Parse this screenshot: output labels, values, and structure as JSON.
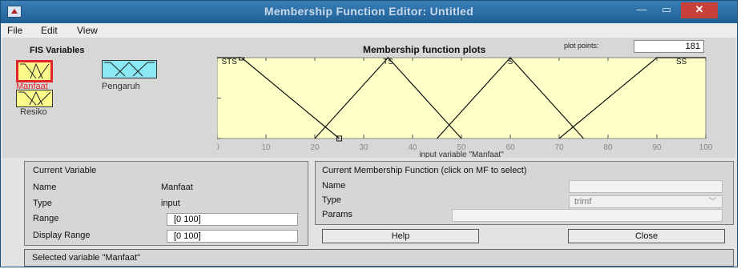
{
  "window": {
    "title": "Membership Function Editor: Untitled",
    "controls": {
      "minimize": "—",
      "maximize": "▭",
      "close": "✕"
    }
  },
  "menu": [
    "File",
    "Edit",
    "View"
  ],
  "fis": {
    "label": "FIS Variables",
    "variables": [
      {
        "name": "Manfaat",
        "selected": true,
        "kind": "input"
      },
      {
        "name": "Pengaruh",
        "selected": false,
        "kind": "output"
      },
      {
        "name": "Resiko",
        "selected": false,
        "kind": "input"
      }
    ]
  },
  "plot": {
    "title": "Membership function plots",
    "plot_points_label": "plot points:",
    "plot_points_value": "181",
    "xlabel": "input variable \"Manfaat\"",
    "xlim": [
      0,
      100
    ],
    "ylim": [
      0,
      1
    ],
    "xticks": [
      "0",
      "10",
      "20",
      "30",
      "40",
      "50",
      "60",
      "70",
      "80",
      "90",
      "100"
    ],
    "yticks": [
      "0",
      "0.5",
      "1"
    ],
    "background": "#ffffc8",
    "mfs": [
      {
        "name": "STS",
        "type": "trimf",
        "params": [
          0,
          5,
          25
        ],
        "points": [
          [
            0,
            1
          ],
          [
            5,
            1
          ],
          [
            25,
            0
          ]
        ]
      },
      {
        "name": "TS",
        "type": "trimf",
        "params": [
          20,
          35,
          50
        ],
        "points": [
          [
            20,
            0
          ],
          [
            35,
            1
          ],
          [
            50,
            0
          ]
        ]
      },
      {
        "name": "S",
        "type": "trimf",
        "params": [
          45,
          60,
          75
        ],
        "points": [
          [
            45,
            0
          ],
          [
            60,
            1
          ],
          [
            75,
            0
          ]
        ]
      },
      {
        "name": "SS",
        "type": "trimf",
        "params": [
          70,
          90,
          100
        ],
        "points": [
          [
            70,
            0
          ],
          [
            90,
            1
          ],
          [
            100,
            1
          ]
        ]
      }
    ]
  },
  "current_variable": {
    "title": "Current Variable",
    "name_label": "Name",
    "name_value": "Manfaat",
    "type_label": "Type",
    "type_value": "input",
    "range_label": "Range",
    "range_value": "[0 100]",
    "display_range_label": "Display Range",
    "display_range_value": "[0 100]"
  },
  "current_mf": {
    "title": "Current Membership Function (click on MF to select)",
    "name_label": "Name",
    "name_value": "",
    "type_label": "Type",
    "type_value": "trimf",
    "params_label": "Params",
    "params_value": ""
  },
  "buttons": {
    "help": "Help",
    "close": "Close"
  },
  "status": "Selected variable \"Manfaat\""
}
